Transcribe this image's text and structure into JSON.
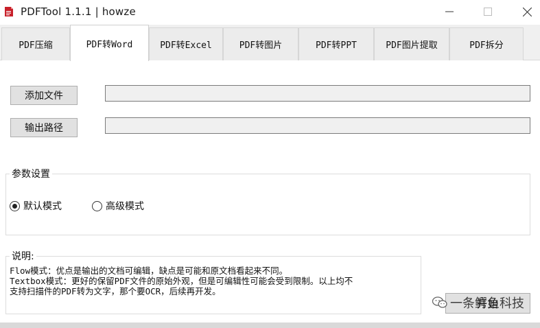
{
  "window": {
    "title": "PDFTool 1.1.1 | howze",
    "app_icon": "pdf-app-icon",
    "controls": {
      "minimize": "minimize-icon",
      "maximize": "maximize-icon",
      "close": "close-icon"
    }
  },
  "tabs": [
    {
      "label": "PDF压缩",
      "active": false
    },
    {
      "label": "PDF转Word",
      "active": true
    },
    {
      "label": "PDF转Excel",
      "active": false
    },
    {
      "label": "PDF转图片",
      "active": false
    },
    {
      "label": "PDF转PPT",
      "active": false
    },
    {
      "label": "PDF图片提取",
      "active": false
    },
    {
      "label": "PDF拆分",
      "active": false
    }
  ],
  "file_row": {
    "button_label": "添加文件",
    "value": ""
  },
  "output_row": {
    "button_label": "输出路径",
    "value": ""
  },
  "params": {
    "title": "参数设置",
    "options": [
      {
        "label": "默认模式",
        "checked": true
      },
      {
        "label": "高级模式",
        "checked": false
      }
    ]
  },
  "description": {
    "title": "说明:",
    "lines": [
      "Flow模式：优点是输出的文档可编辑，缺点是可能和原文档看起来不同。",
      "Textbox模式：更好的保留PDF文件的原始外观，但是可编辑性可能会受到限制。以上均不",
      "支持扫描件的PDF转为文字，那个要OCR，后续再开发。"
    ]
  },
  "start_button": {
    "label": "开始"
  },
  "watermark": {
    "text": "一条鳄鱼科技",
    "icon": "wechat-icon"
  },
  "colors": {
    "pdf_red": "#c8202a",
    "button_bg": "#e1e1e1",
    "tab_bg": "#ececec"
  }
}
